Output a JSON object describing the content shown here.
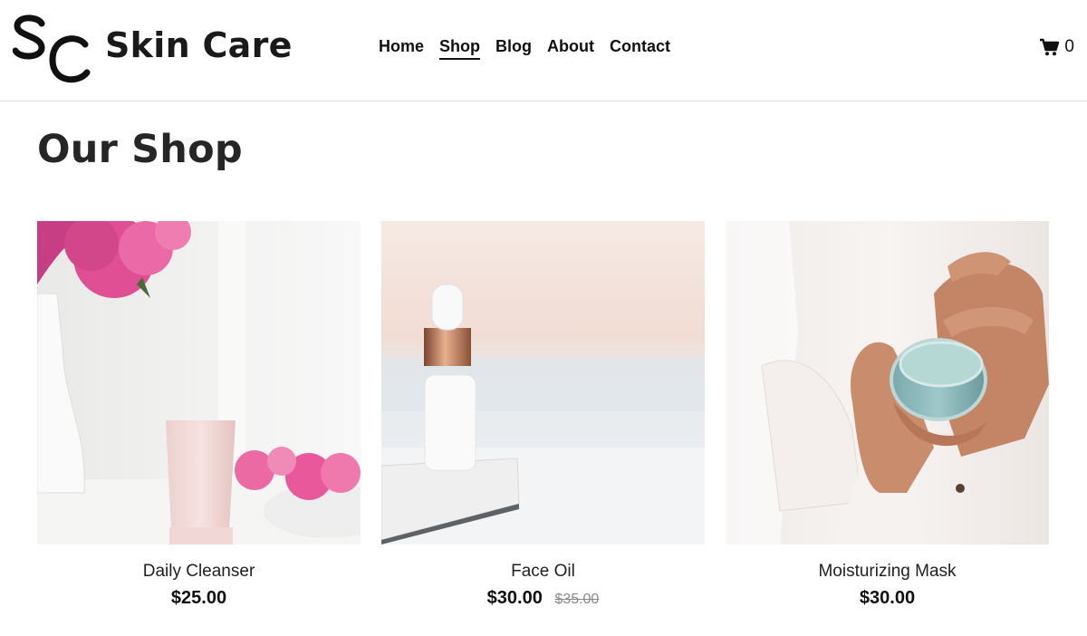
{
  "brand": {
    "monogram": "SC",
    "name": "Skin Care"
  },
  "nav": {
    "items": [
      {
        "label": "Home",
        "active": false
      },
      {
        "label": "Shop",
        "active": true
      },
      {
        "label": "Blog",
        "active": false
      },
      {
        "label": "About",
        "active": false
      },
      {
        "label": "Contact",
        "active": false
      }
    ]
  },
  "cart": {
    "icon": "cart-icon",
    "count": "0"
  },
  "page": {
    "title": "Our Shop"
  },
  "products": [
    {
      "name": "Daily Cleanser",
      "price": "$25.00",
      "image": "cleanser-photo"
    },
    {
      "name": "Face Oil",
      "price": "$30.00",
      "old_price": "$35.00",
      "image": "face-oil-photo"
    },
    {
      "name": "Moisturizing Mask",
      "price": "$30.00",
      "image": "mask-photo"
    }
  ],
  "colors": {
    "text": "#1a1a1a",
    "strike": "#888888",
    "divider": "#dcdcdc",
    "accent_pink": "#e04f93"
  }
}
